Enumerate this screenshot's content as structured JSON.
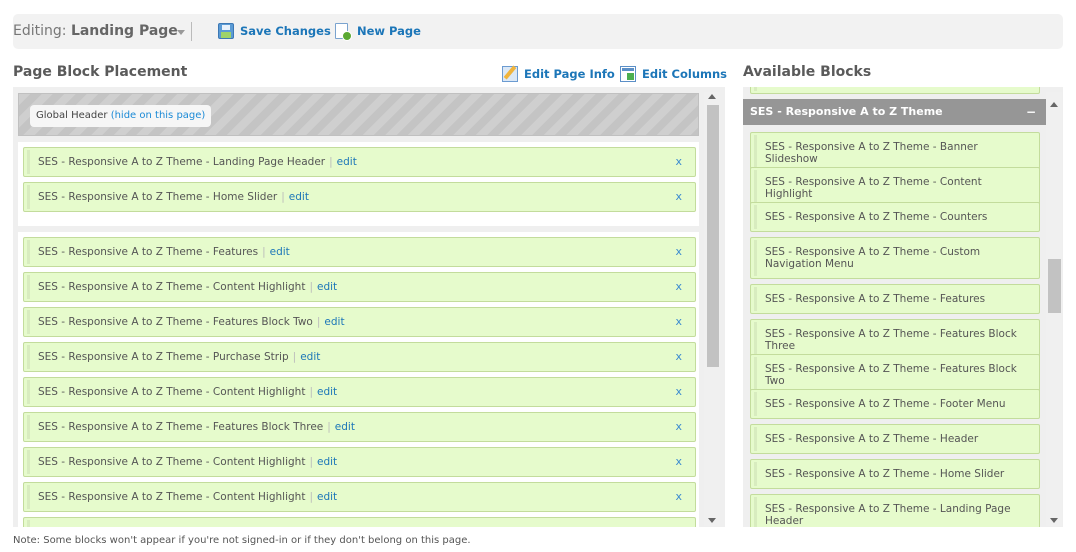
{
  "toolbar": {
    "editing_prefix": "Editing:",
    "page_name": "Landing Page",
    "save_label": "Save Changes",
    "new_page_label": "New Page",
    "icons": {
      "save": "floppy-disk-icon",
      "new_page": "new-page-icon",
      "dropdown": "caret-down-icon"
    }
  },
  "placement": {
    "title": "Page Block Placement",
    "edit_page_info": "Edit Page Info",
    "edit_columns": "Edit Columns",
    "global_header": {
      "label": "Global Header",
      "link": "(hide on this page)"
    },
    "edit_label": "edit",
    "remove_label": "x",
    "regions": [
      {
        "blocks": [
          "SES - Responsive A to Z Theme - Landing Page Header",
          "SES - Responsive A to Z Theme - Home Slider"
        ]
      },
      {
        "blocks": [
          "SES - Responsive A to Z Theme - Features",
          "SES - Responsive A to Z Theme - Content Highlight",
          "SES - Responsive A to Z Theme - Features Block Two",
          "SES - Responsive A to Z Theme - Purchase Strip",
          "SES - Responsive A to Z Theme - Content Highlight",
          "SES - Responsive A to Z Theme - Features Block Three",
          "SES - Responsive A to Z Theme - Content Highlight",
          "SES - Responsive A to Z Theme - Content Highlight"
        ]
      }
    ]
  },
  "available": {
    "title": "Available Blocks",
    "group": {
      "name": "SES - Responsive A to Z Theme",
      "collapse_symbol": "−"
    },
    "blocks": [
      "SES - Responsive A to Z Theme - Banner Slideshow",
      "SES - Responsive A to Z Theme - Content Highlight",
      "SES - Responsive A to Z Theme - Counters",
      "SES - Responsive A to Z Theme - Custom Navigation Menu",
      "SES - Responsive A to Z Theme - Features",
      "SES - Responsive A to Z Theme - Features Block Three",
      "SES - Responsive A to Z Theme - Features Block Two",
      "SES - Responsive A to Z Theme - Footer Menu",
      "SES - Responsive A to Z Theme - Header",
      "SES - Responsive A to Z Theme - Home Slider",
      "SES - Responsive A to Z Theme - Landing Page Header"
    ]
  },
  "note": "Note: Some blocks won't appear if you're not signed-in or if they don't belong on this page.",
  "colors": {
    "link": "#1c76b8",
    "block_bg": "#e6fbcc",
    "block_border": "#c3dc9c",
    "group_header": "#969696"
  }
}
